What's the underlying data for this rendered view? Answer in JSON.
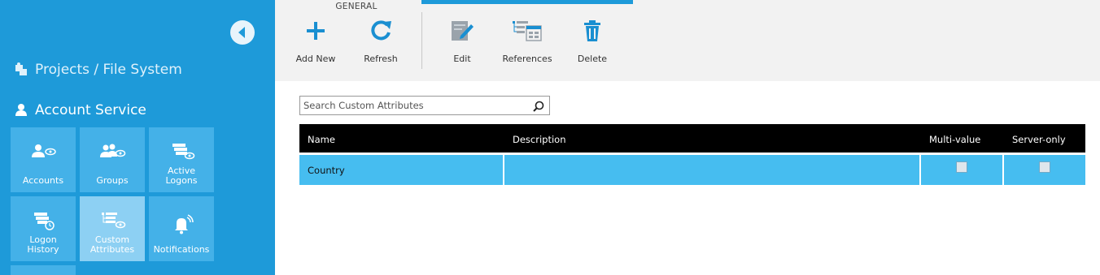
{
  "sidebar": {
    "projects_label": "Projects / File System",
    "account_label": "Account Service",
    "tiles": [
      {
        "label_line1": "Accounts",
        "label_line2": ""
      },
      {
        "label_line1": "Groups",
        "label_line2": ""
      },
      {
        "label_line1": "Active",
        "label_line2": "Logons"
      },
      {
        "label_line1": "Logon",
        "label_line2": "History"
      },
      {
        "label_line1": "Custom",
        "label_line2": "Attributes"
      },
      {
        "label_line1": "Notifications",
        "label_line2": ""
      }
    ],
    "active_tile": "Custom Attributes"
  },
  "ribbon": {
    "group_label": "GENERAL",
    "buttons": {
      "add_new": "Add New",
      "refresh": "Refresh",
      "edit": "Edit",
      "references": "References",
      "delete": "Delete"
    }
  },
  "search": {
    "placeholder": "Search Custom Attributes",
    "value": ""
  },
  "table": {
    "columns": [
      "Name",
      "Description",
      "Multi-value",
      "Server-only"
    ],
    "rows": [
      {
        "name": "Country",
        "description": "",
        "multi_value": false,
        "server_only": false
      }
    ]
  },
  "colors": {
    "sidebar_bg": "#1e9ad9",
    "tile_bg": "#44b1e8",
    "tile_active_bg": "#8dd0f3",
    "header_bg": "#000000",
    "row_selected_bg": "#46bdf0",
    "icon_blue": "#1a8fd1"
  }
}
